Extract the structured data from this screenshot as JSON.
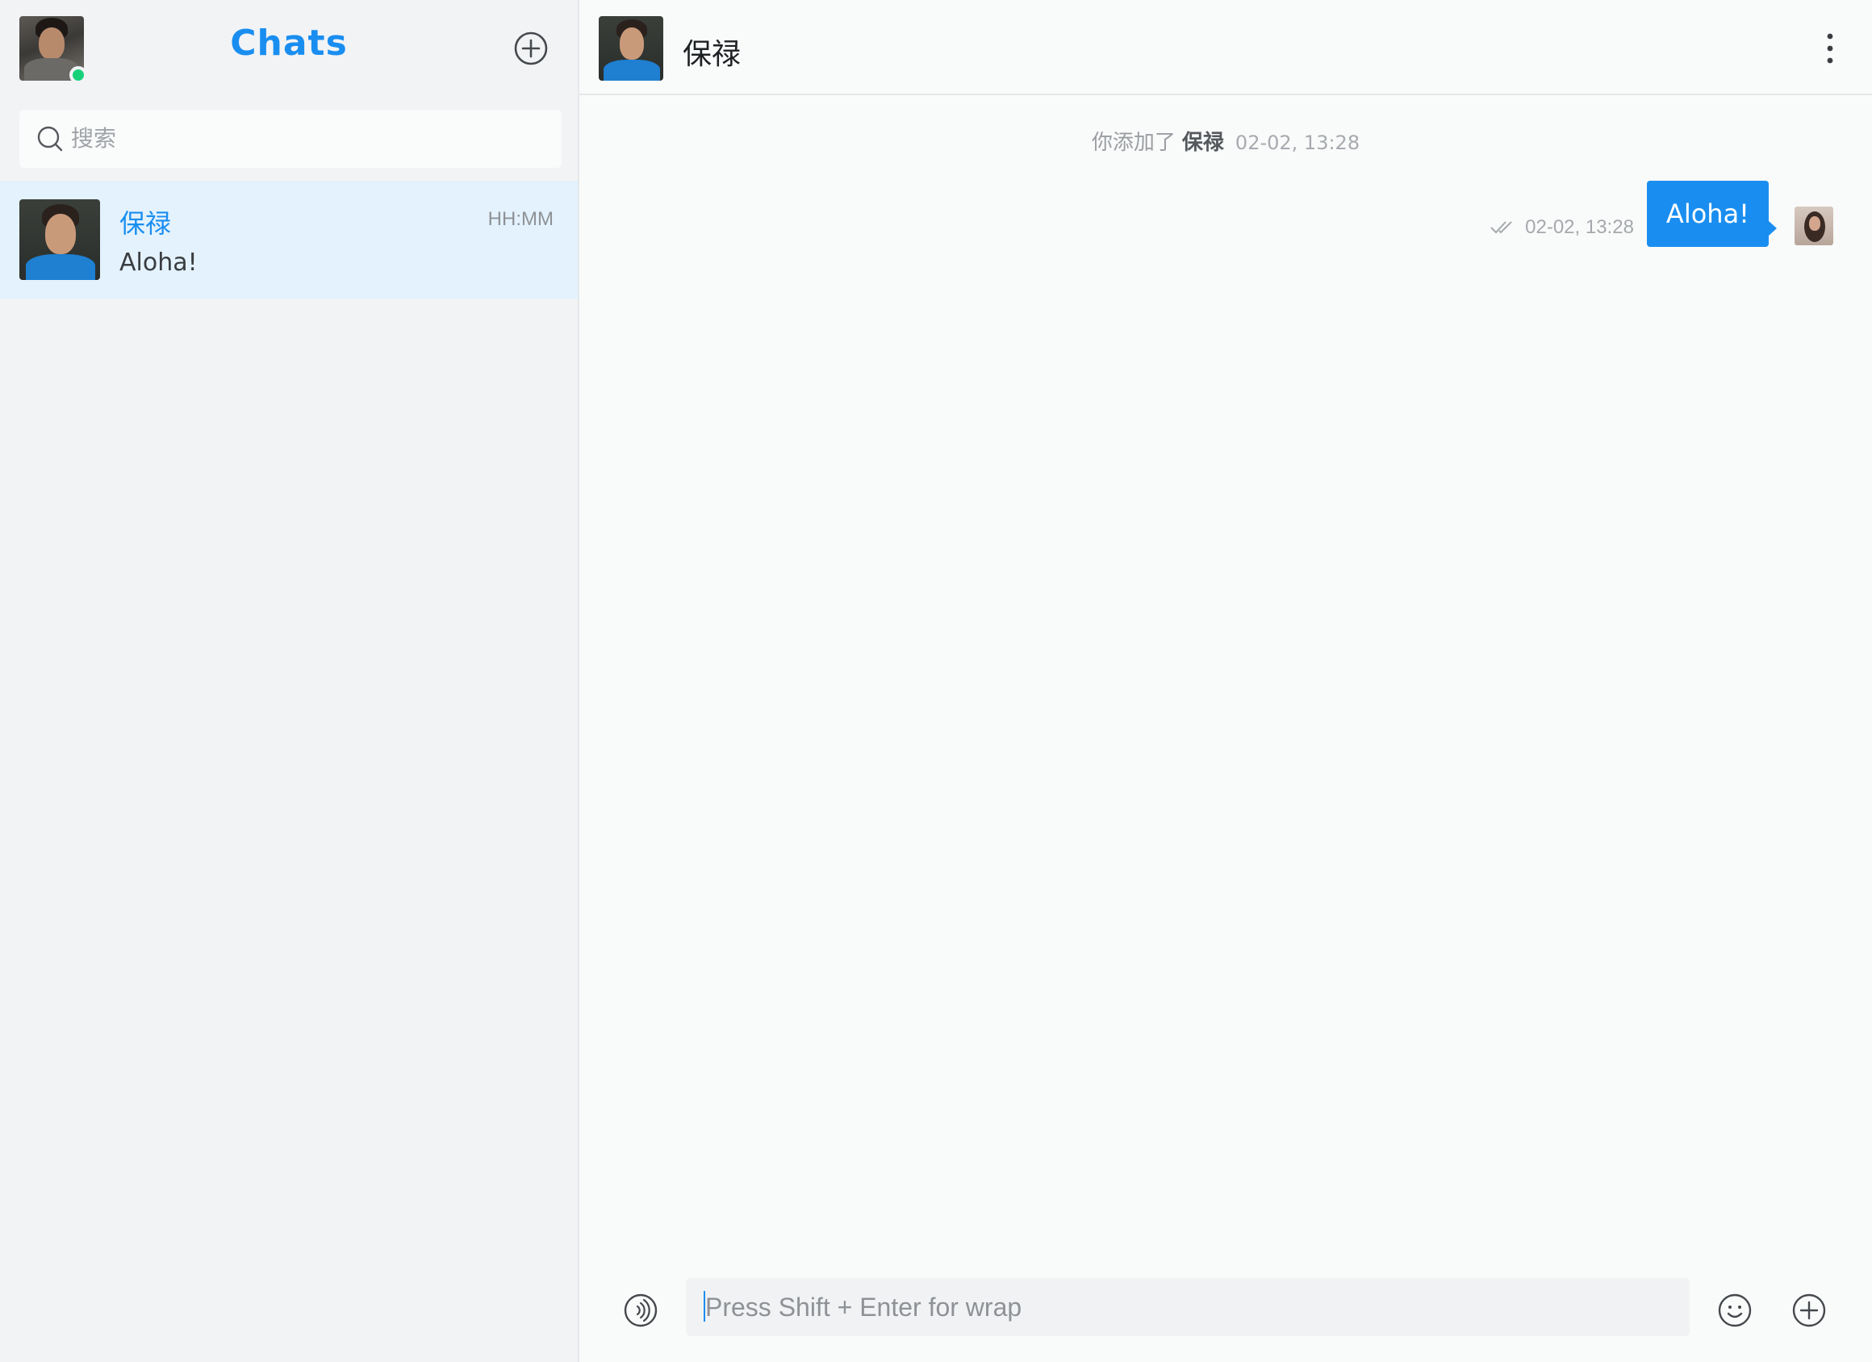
{
  "sidebar": {
    "title": "Chats",
    "search": {
      "placeholder": "搜索",
      "value": ""
    },
    "chats": [
      {
        "name": "保禄",
        "preview": "Aloha!",
        "time": "HH:MM"
      }
    ]
  },
  "conversation": {
    "contact_name": "保禄",
    "system_message": {
      "text": "你添加了",
      "name": "保禄",
      "timestamp": "02-02, 13:28"
    },
    "messages": [
      {
        "text": "Aloha!",
        "timestamp": "02-02, 13:28",
        "status": "read",
        "direction": "outgoing"
      }
    ],
    "composer": {
      "placeholder": "Press Shift + Enter for wrap",
      "value": ""
    }
  },
  "icons": {
    "new_chat": "plus-circle-icon",
    "search": "search-icon",
    "more": "vertical-dots-icon",
    "voice": "voice-icon",
    "emoji": "smiley-icon",
    "attach": "plus-circle-icon",
    "read_receipt": "double-check-icon"
  },
  "colors": {
    "accent": "#1a8ef0",
    "online": "#17d17a",
    "sidebar_bg": "#f2f3f5",
    "selected_chat_bg": "#e3f2fd"
  }
}
